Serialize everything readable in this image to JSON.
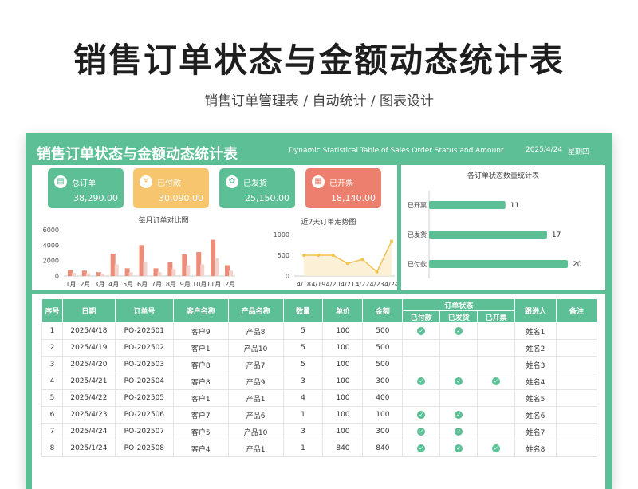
{
  "page": {
    "title": "销售订单状态与金额动态统计表",
    "subtitle": "销售订单管理表 / 自动统计 / 图表设计"
  },
  "banner": {
    "title": "销售订单状态与金额动态统计表",
    "subtitle_en": "Dynamic Statistical Table of Sales Order Status and Amount",
    "date": "2025/4/24",
    "weekday": "星期四"
  },
  "cards": [
    {
      "label": "总订单",
      "value": "38,290.00",
      "color": "#5dbf95",
      "icon": "clipboard-icon"
    },
    {
      "label": "已付款",
      "value": "30,090.00",
      "color": "#f7c56e",
      "icon": "coin-icon"
    },
    {
      "label": "已发货",
      "value": "25,150.00",
      "color": "#5dbf95",
      "icon": "box-icon"
    },
    {
      "label": "已开票",
      "value": "18,140.00",
      "color": "#ec7f6d",
      "icon": "invoice-icon"
    }
  ],
  "chart_data": [
    {
      "type": "bar",
      "title": "每月订单对比图",
      "categories": [
        "1月",
        "2月",
        "3月",
        "4月",
        "5月",
        "6月",
        "7月",
        "8月",
        "9月",
        "10月",
        "11月",
        "12月"
      ],
      "series": [
        {
          "values": [
            800,
            700,
            500,
            2900,
            1000,
            4000,
            1000,
            1800,
            2800,
            3100,
            4700,
            1400
          ]
        },
        {
          "values": [
            400,
            350,
            250,
            1500,
            500,
            1900,
            500,
            900,
            1400,
            1500,
            2300,
            700
          ]
        }
      ],
      "yticks": [
        "0",
        "2000",
        "4000",
        "6000"
      ],
      "ylim": [
        0,
        6000
      ]
    },
    {
      "type": "line",
      "title": "近7天订单走势图",
      "categories": [
        "4/18",
        "4/19",
        "4/20",
        "4/21",
        "4/22",
        "4/23",
        "4/24"
      ],
      "values": [
        500,
        500,
        500,
        300,
        400,
        100,
        840
      ],
      "yticks": [
        "0",
        "500",
        "1000"
      ],
      "ylim": [
        0,
        1000
      ]
    },
    {
      "type": "bar",
      "orientation": "horizontal",
      "title": "各订单状态数量统计表",
      "categories": [
        "已开票",
        "已发货",
        "已付款"
      ],
      "values": [
        11,
        17,
        20
      ]
    }
  ],
  "table": {
    "headers": [
      "序号",
      "日期",
      "订单号",
      "客户名称",
      "产品名称",
      "数量",
      "单价",
      "金额",
      "订单状态",
      "跟进人",
      "备注"
    ],
    "status_headers": [
      "已付款",
      "已发货",
      "已开票"
    ],
    "rows": [
      {
        "no": "1",
        "date": "2025/4/18",
        "order": "PO-202501",
        "customer": "客户9",
        "product": "产品8",
        "qty": "5",
        "price": "100",
        "amount": "500",
        "paid": true,
        "shipped": true,
        "invoiced": false,
        "owner": "姓名1",
        "note": ""
      },
      {
        "no": "2",
        "date": "2025/4/19",
        "order": "PO-202502",
        "customer": "客户1",
        "product": "产品10",
        "qty": "5",
        "price": "100",
        "amount": "500",
        "paid": false,
        "shipped": false,
        "invoiced": false,
        "owner": "姓名2",
        "note": ""
      },
      {
        "no": "3",
        "date": "2025/4/20",
        "order": "PO-202503",
        "customer": "客户8",
        "product": "产品7",
        "qty": "5",
        "price": "100",
        "amount": "500",
        "paid": false,
        "shipped": false,
        "invoiced": false,
        "owner": "姓名3",
        "note": ""
      },
      {
        "no": "4",
        "date": "2025/4/21",
        "order": "PO-202504",
        "customer": "客户8",
        "product": "产品9",
        "qty": "3",
        "price": "100",
        "amount": "300",
        "paid": true,
        "shipped": true,
        "invoiced": true,
        "owner": "姓名4",
        "note": ""
      },
      {
        "no": "5",
        "date": "2025/4/22",
        "order": "PO-202505",
        "customer": "客户1",
        "product": "产品1",
        "qty": "4",
        "price": "100",
        "amount": "400",
        "paid": false,
        "shipped": false,
        "invoiced": false,
        "owner": "姓名5",
        "note": ""
      },
      {
        "no": "6",
        "date": "2025/4/23",
        "order": "PO-202506",
        "customer": "客户7",
        "product": "产品6",
        "qty": "1",
        "price": "100",
        "amount": "100",
        "paid": true,
        "shipped": true,
        "invoiced": false,
        "owner": "姓名6",
        "note": ""
      },
      {
        "no": "7",
        "date": "2025/4/24",
        "order": "PO-202507",
        "customer": "客户5",
        "product": "产品10",
        "qty": "3",
        "price": "100",
        "amount": "300",
        "paid": true,
        "shipped": true,
        "invoiced": false,
        "owner": "姓名7",
        "note": ""
      },
      {
        "no": "8",
        "date": "2025/1/24",
        "order": "PO-202508",
        "customer": "客户4",
        "product": "产品1",
        "qty": "1",
        "price": "840",
        "amount": "840",
        "paid": true,
        "shipped": true,
        "invoiced": true,
        "owner": "姓名8",
        "note": ""
      }
    ]
  }
}
